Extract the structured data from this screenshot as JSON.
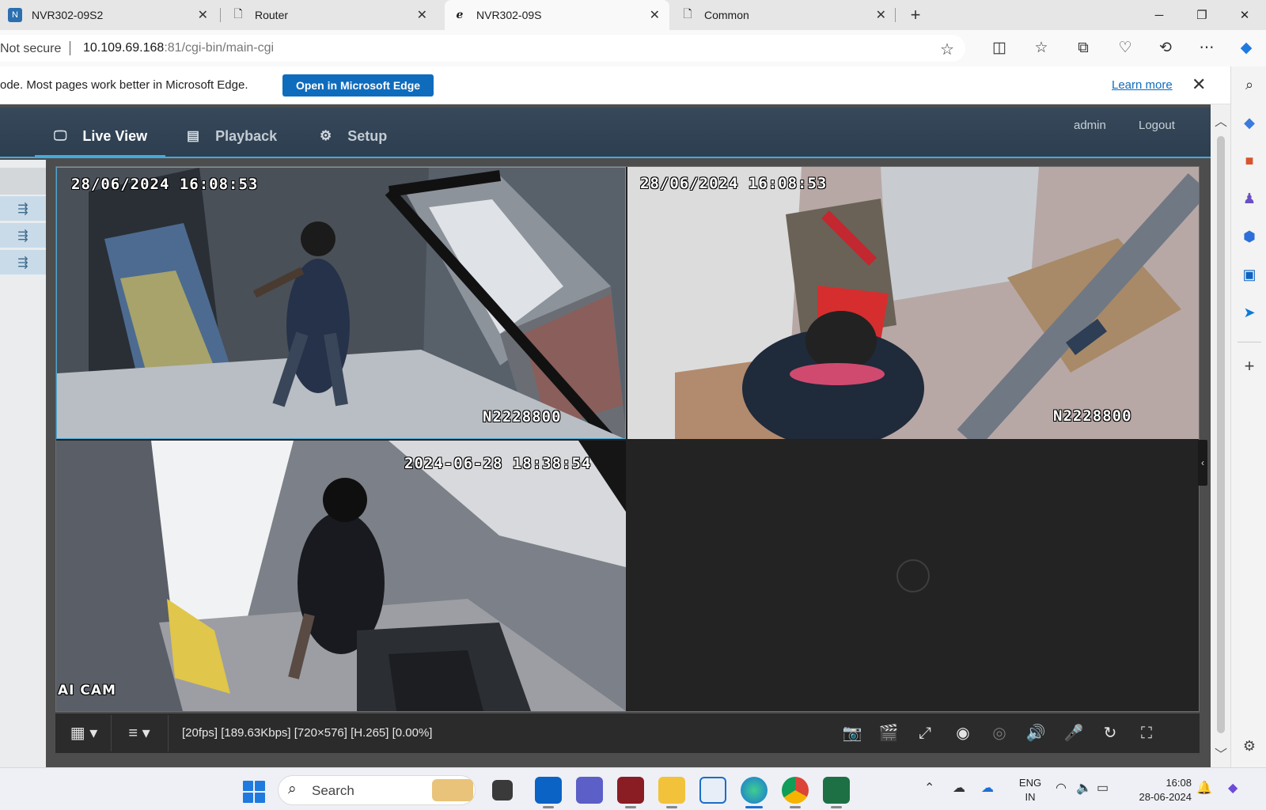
{
  "browser": {
    "tabs": [
      {
        "title": "NVR302-09S2",
        "icon": "nvr-icon"
      },
      {
        "title": "Router",
        "icon": "page-icon"
      },
      {
        "title": "NVR302-09S",
        "icon": "ie-icon",
        "active": true
      },
      {
        "title": "Common",
        "icon": "page-icon"
      }
    ],
    "address": {
      "not_secure": "Not secure",
      "url_host": "10.109.69.168",
      "url_rest": ":81/cgi-bin/main-cgi"
    },
    "infobar": {
      "message": "ode. Most pages work better in Microsoft Edge.",
      "open_button": "Open in Microsoft Edge",
      "learn_more": "Learn more"
    }
  },
  "nvr": {
    "nav": {
      "live_view": "Live View",
      "playback": "Playback",
      "setup": "Setup"
    },
    "user": "admin",
    "logout": "Logout",
    "cameras": [
      {
        "timestamp": "28/06/2024 16:08:53",
        "label": "N2228800"
      },
      {
        "timestamp": "28/06/2024 16:08:53",
        "label": "N2228800"
      },
      {
        "timestamp": "2024-06-28 18:38:54",
        "label": "AI CAM"
      },
      {
        "timestamp": "",
        "label": ""
      }
    ],
    "stream_info": "[20fps] [189.63Kbps] [720×576] [H.265] [0.00%]"
  },
  "taskbar": {
    "search_placeholder": "Search",
    "language_top": "ENG",
    "language_bottom": "IN",
    "time": "16:08",
    "date": "28-06-2024"
  },
  "colors": {
    "accent": "#46a9da",
    "header": "#2c3e50",
    "edge_blue": "#0f6cbd"
  }
}
